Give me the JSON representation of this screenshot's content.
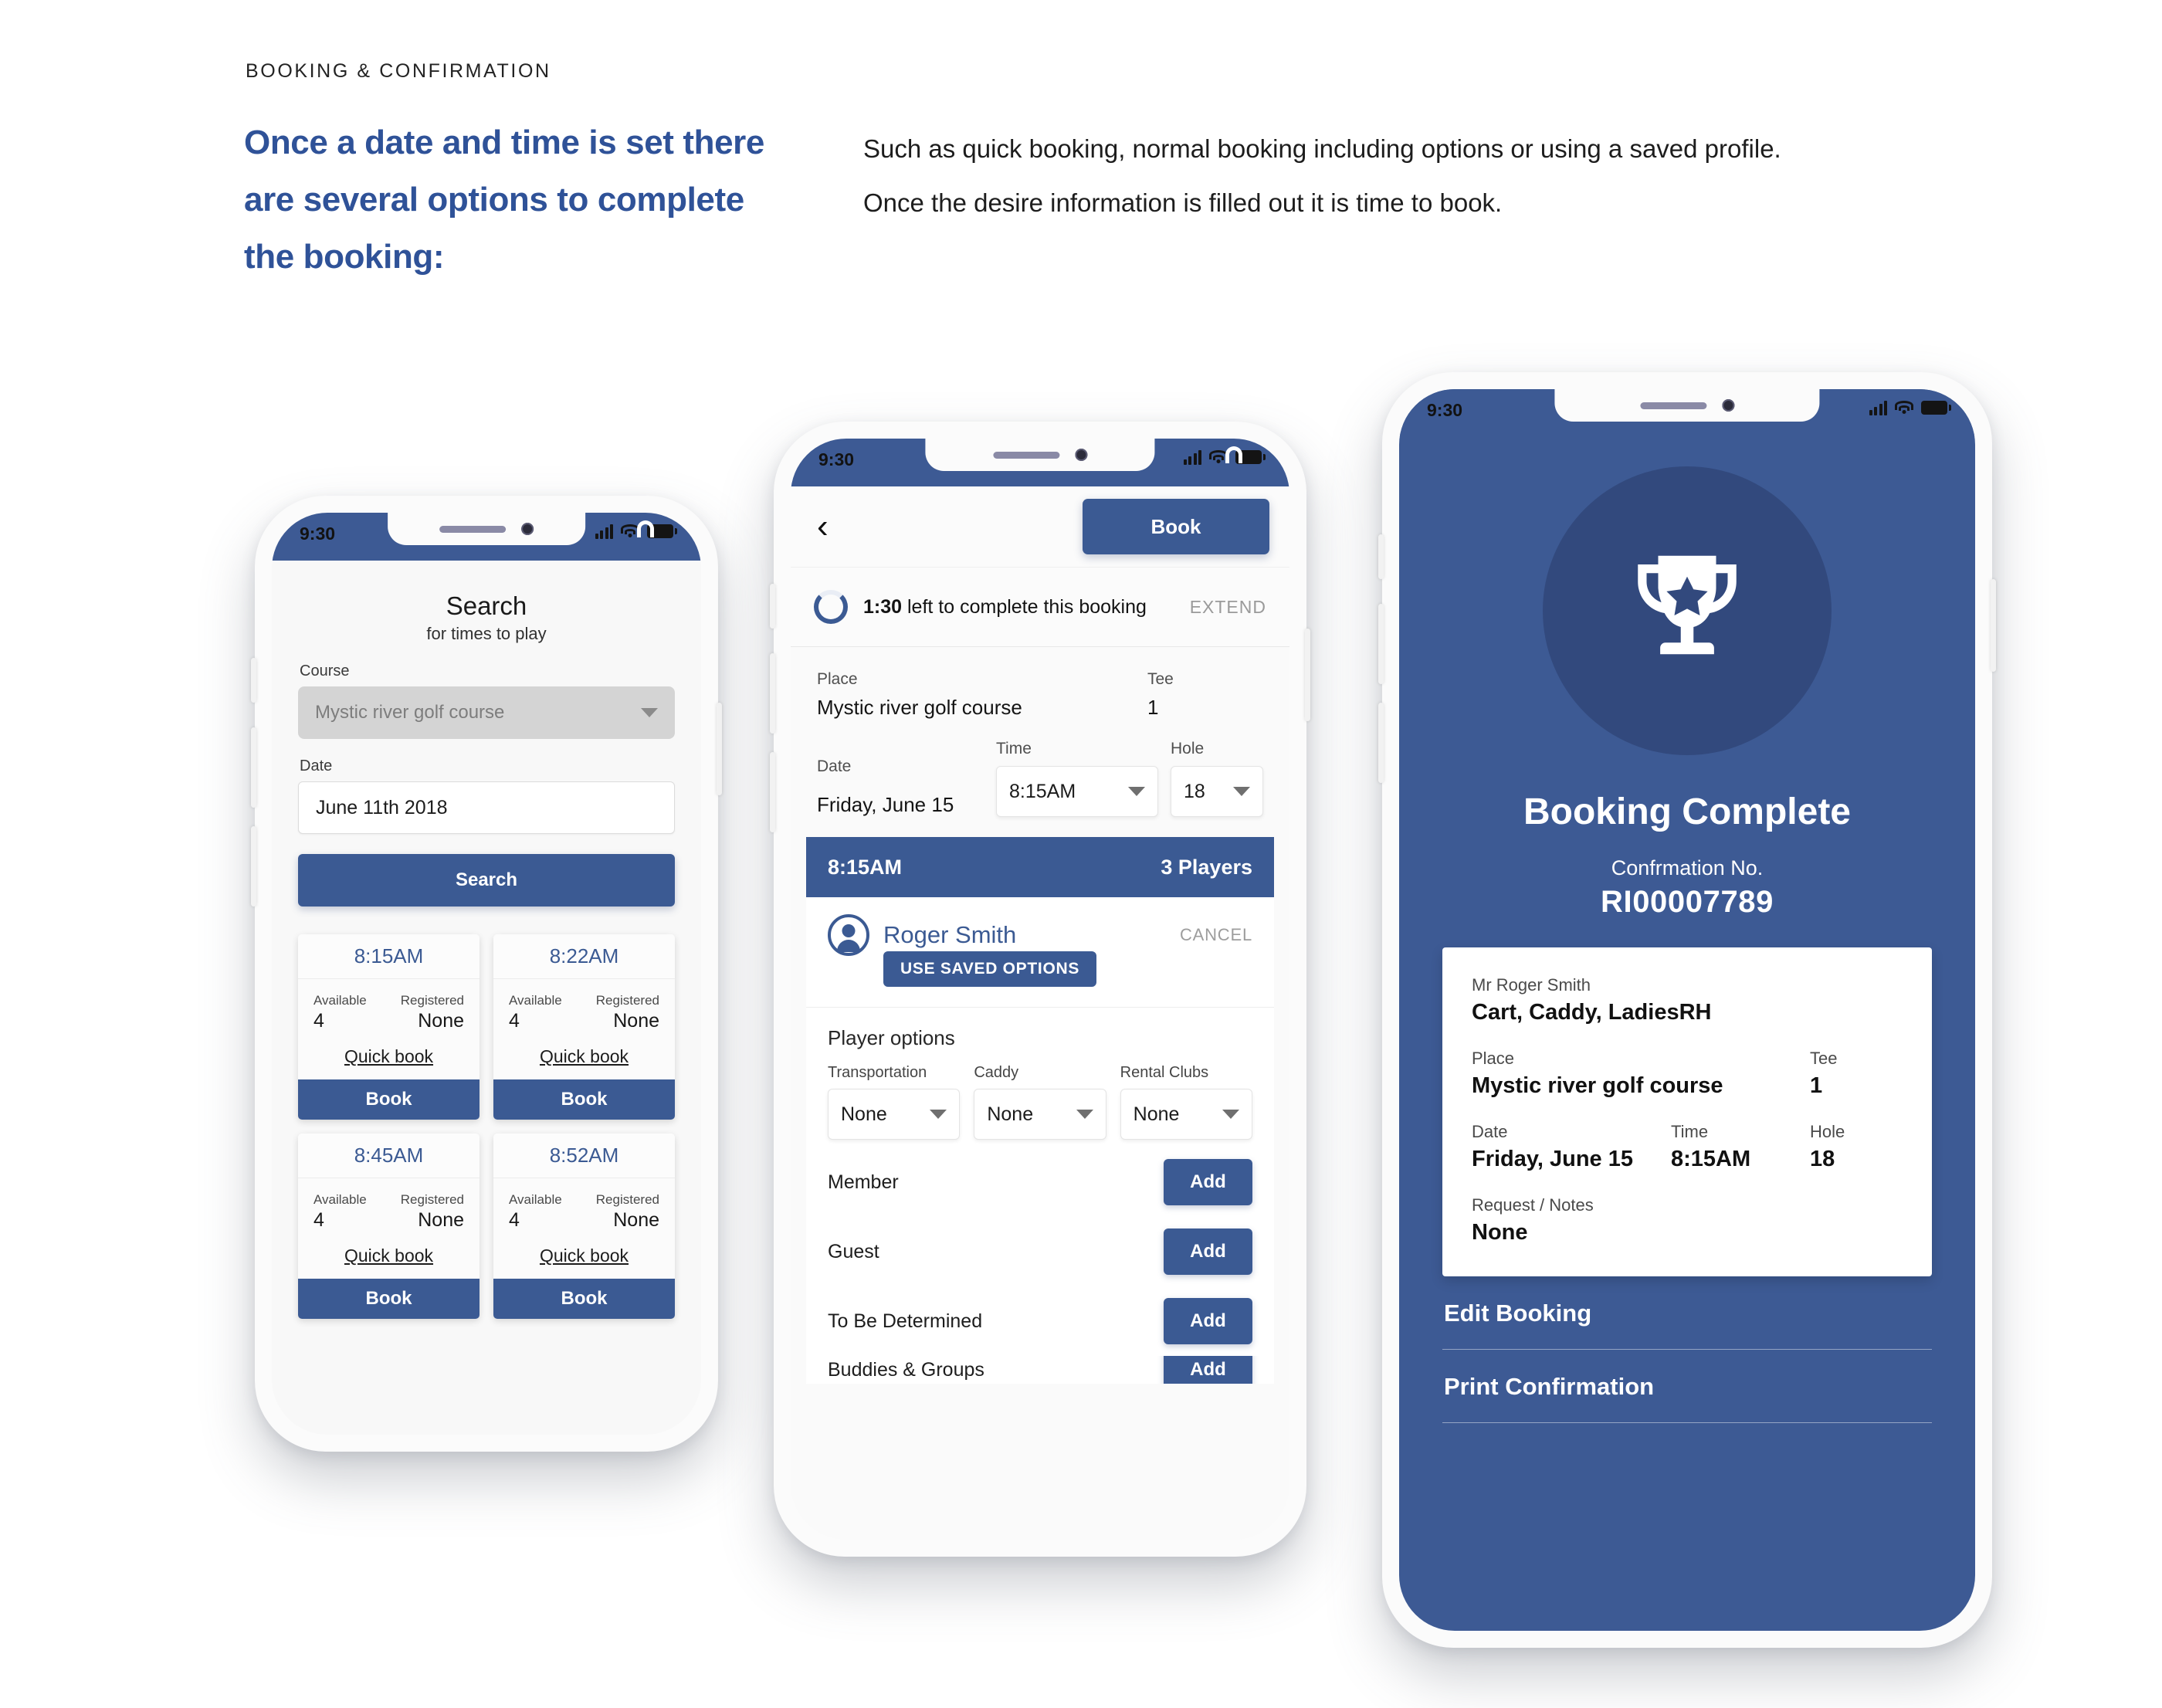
{
  "header": {
    "eyebrow": "BOOKING & CONFIRMATION",
    "headline": "Once a date and time is set there are several options to complete the booking:",
    "lede": "Such as quick booking, normal booking including options or using a saved profile. Once the desire information is filled out it is time to book."
  },
  "colors": {
    "brand_blue": "#3b5a93",
    "screen_blue": "#3d5a94",
    "circle_blue": "#32497d",
    "heading_blue": "#2f5298"
  },
  "phone1": {
    "status": {
      "time": "9:30"
    },
    "title": "Search",
    "subtitle": "for times to play",
    "course_label": "Course",
    "course_value": "Mystic river golf course",
    "date_label": "Date",
    "date_value": "June 11th 2018",
    "search_button": "Search",
    "tee_times": [
      {
        "time": "8:15AM",
        "available_label": "Available",
        "available_value": "4",
        "registered_label": "Registered",
        "registered_value": "None",
        "quick": "Quick book",
        "book": "Book"
      },
      {
        "time": "8:22AM",
        "available_label": "Available",
        "available_value": "4",
        "registered_label": "Registered",
        "registered_value": "None",
        "quick": "Quick book",
        "book": "Book"
      },
      {
        "time": "8:45AM",
        "available_label": "Available",
        "available_value": "4",
        "registered_label": "Registered",
        "registered_value": "None",
        "quick": "Quick book",
        "book": "Book"
      },
      {
        "time": "8:52AM",
        "available_label": "Available",
        "available_value": "4",
        "registered_label": "Registered",
        "registered_value": "None",
        "quick": "Quick book",
        "book": "Book"
      }
    ]
  },
  "phone2": {
    "status": {
      "time": "9:30"
    },
    "book_button": "Book",
    "timer": {
      "remaining": "1:30",
      "text": " left to complete this booking",
      "extend": "EXTEND"
    },
    "place_label": "Place",
    "place_value": "Mystic river golf course",
    "tee_label": "Tee",
    "tee_value": "1",
    "date_label": "Date",
    "date_value": "Friday, June 15",
    "time_label": "Time",
    "time_value": "8:15AM",
    "hole_label": "Hole",
    "hole_value": "18",
    "slot_time": "8:15AM",
    "slot_players": "3 Players",
    "player_name": "Roger Smith",
    "cancel": "CANCEL",
    "saved_options": "USE SAVED OPTIONS",
    "options_title": "Player options",
    "options": [
      {
        "label": "Transportation",
        "value": "None"
      },
      {
        "label": "Caddy",
        "value": "None"
      },
      {
        "label": "Rental Clubs",
        "value": "None"
      }
    ],
    "add_rows": [
      {
        "label": "Member",
        "button": "Add"
      },
      {
        "label": "Guest",
        "button": "Add"
      },
      {
        "label": "To Be Determined",
        "button": "Add"
      },
      {
        "label": "Buddies & Groups",
        "button": "Add"
      }
    ]
  },
  "phone3": {
    "status": {
      "time": "9:30"
    },
    "title": "Booking Complete",
    "confirmation_label": "Confrmation No.",
    "confirmation_number": "RI00007789",
    "card": {
      "person": "Mr Roger Smith",
      "options": "Cart, Caddy, LadiesRH",
      "place_label": "Place",
      "place_value": "Mystic river golf course",
      "tee_label": "Tee",
      "tee_value": "1",
      "date_label": "Date",
      "date_value": "Friday, June 15",
      "time_label": "Time",
      "time_value": "8:15AM",
      "hole_label": "Hole",
      "hole_value": "18",
      "notes_label": "Request / Notes",
      "notes_value": "None"
    },
    "edit_link": "Edit Booking",
    "print_link": "Print Confirmation"
  }
}
